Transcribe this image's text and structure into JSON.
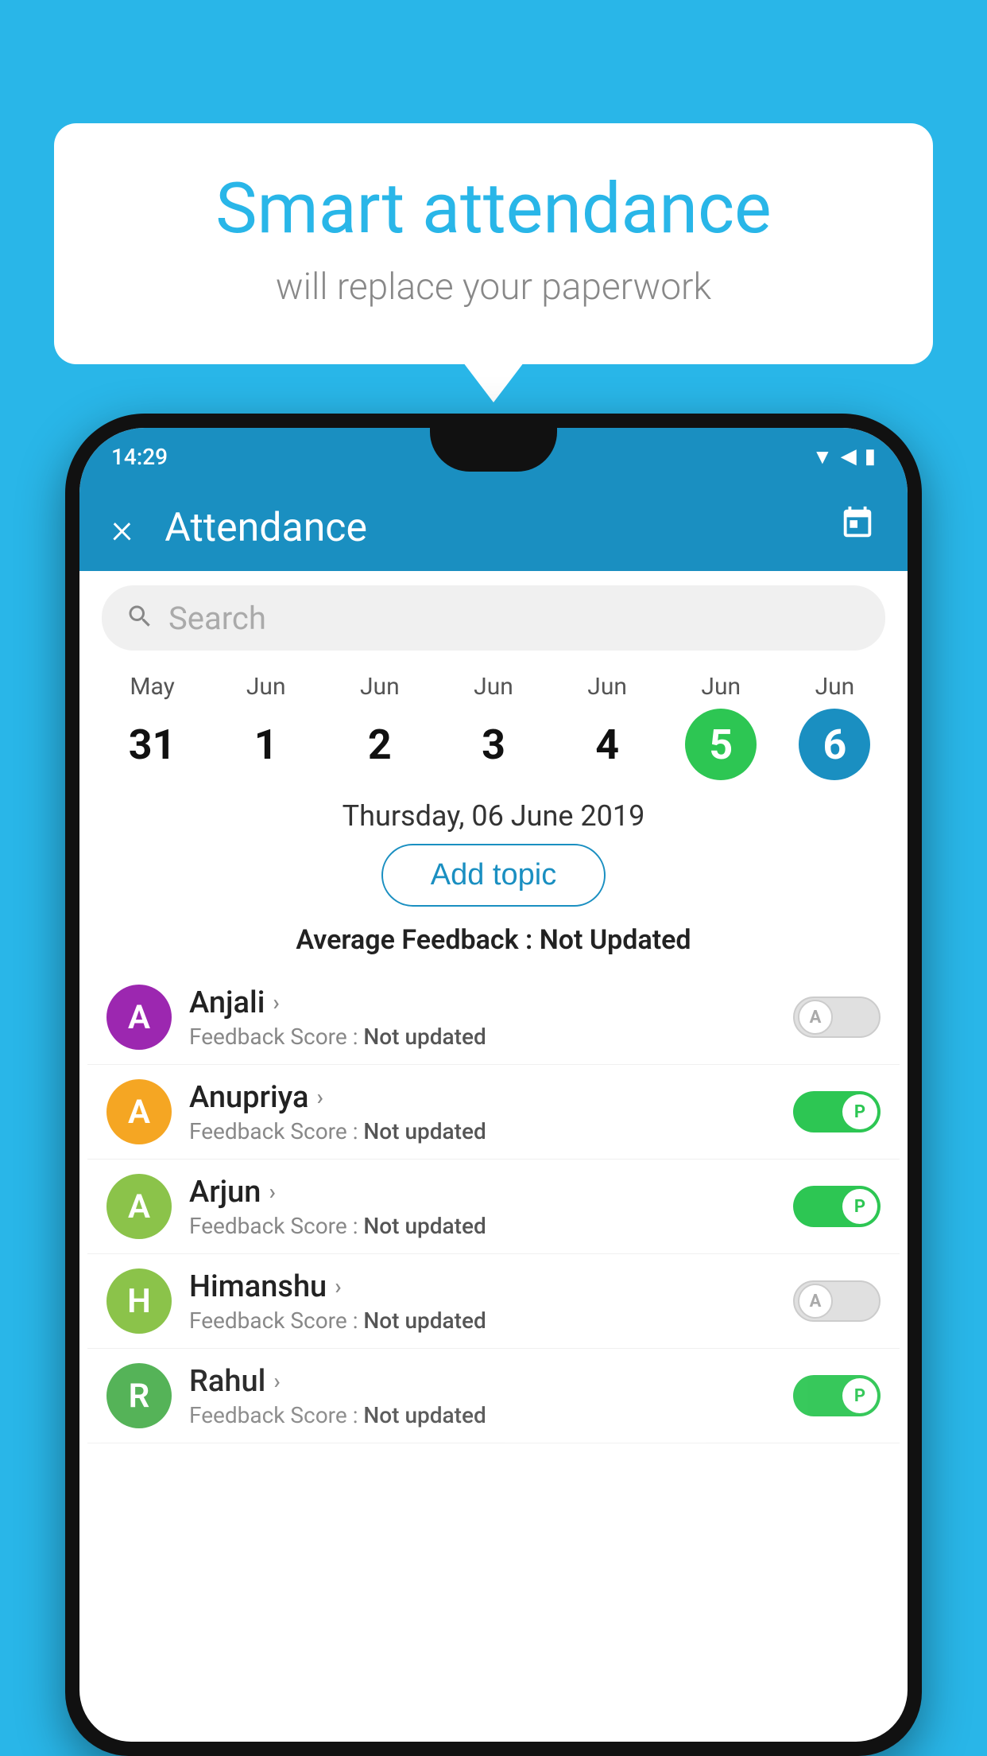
{
  "background_color": "#29b6e8",
  "speech_bubble": {
    "title": "Smart attendance",
    "subtitle": "will replace your paperwork"
  },
  "status_bar": {
    "time": "14:29",
    "icons": [
      "wifi",
      "signal",
      "battery"
    ]
  },
  "app_bar": {
    "title": "Attendance",
    "close_label": "×",
    "calendar_label": "📅"
  },
  "search": {
    "placeholder": "Search"
  },
  "calendar": {
    "days": [
      {
        "month": "May",
        "num": "31",
        "state": "normal"
      },
      {
        "month": "Jun",
        "num": "1",
        "state": "normal"
      },
      {
        "month": "Jun",
        "num": "2",
        "state": "normal"
      },
      {
        "month": "Jun",
        "num": "3",
        "state": "normal"
      },
      {
        "month": "Jun",
        "num": "4",
        "state": "normal"
      },
      {
        "month": "Jun",
        "num": "5",
        "state": "today"
      },
      {
        "month": "Jun",
        "num": "6",
        "state": "selected"
      }
    ]
  },
  "selected_date": "Thursday, 06 June 2019",
  "add_topic_label": "Add topic",
  "average_feedback": {
    "label": "Average Feedback :",
    "value": "Not Updated"
  },
  "students": [
    {
      "name": "Anjali",
      "initial": "A",
      "avatar_color": "#9c27b0",
      "feedback_label": "Feedback Score :",
      "feedback_value": "Not updated",
      "toggle_state": "off",
      "toggle_label": "A"
    },
    {
      "name": "Anupriya",
      "initial": "A",
      "avatar_color": "#f5a623",
      "feedback_label": "Feedback Score :",
      "feedback_value": "Not updated",
      "toggle_state": "on",
      "toggle_label": "P"
    },
    {
      "name": "Arjun",
      "initial": "A",
      "avatar_color": "#8bc34a",
      "feedback_label": "Feedback Score :",
      "feedback_value": "Not updated",
      "toggle_state": "on",
      "toggle_label": "P"
    },
    {
      "name": "Himanshu",
      "initial": "H",
      "avatar_color": "#8bc34a",
      "feedback_label": "Feedback Score :",
      "feedback_value": "Not updated",
      "toggle_state": "off",
      "toggle_label": "A"
    },
    {
      "name": "Rahul",
      "initial": "R",
      "avatar_color": "#4caf50",
      "feedback_label": "Feedback Score :",
      "feedback_value": "Not updated",
      "toggle_state": "on",
      "toggle_label": "P"
    }
  ]
}
